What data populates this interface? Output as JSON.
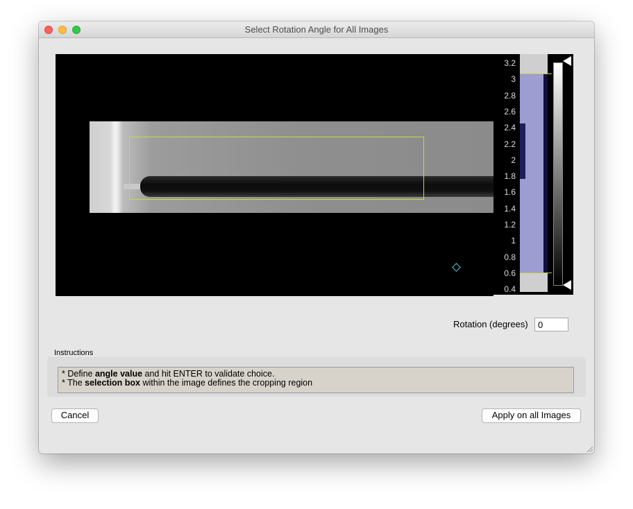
{
  "window": {
    "title": "Select Rotation Angle for All Images"
  },
  "histogram": {
    "axis_ticks": [
      "3.2",
      "3",
      "2.8",
      "2.6",
      "2.4",
      "2.2",
      "2",
      "1.8",
      "1.6",
      "1.4",
      "1.2",
      "1",
      "0.8",
      "0.6",
      "0.4"
    ]
  },
  "rotation": {
    "label": "Rotation (degrees)",
    "value": "0"
  },
  "instructions": {
    "title": "Instructions",
    "line1_prefix": "* Define ",
    "line1_bold": "angle value",
    "line1_suffix": " and hit ENTER to validate choice.",
    "line2_prefix": "* The ",
    "line2_bold": "selection box",
    "line2_suffix": " within the image defines the cropping region"
  },
  "buttons": {
    "cancel": "Cancel",
    "apply": "Apply on all Images"
  },
  "colors": {
    "selection_box": "#c7dc3c",
    "histogram_fill": "#9d9dd2",
    "handle": "#55d0d8"
  }
}
